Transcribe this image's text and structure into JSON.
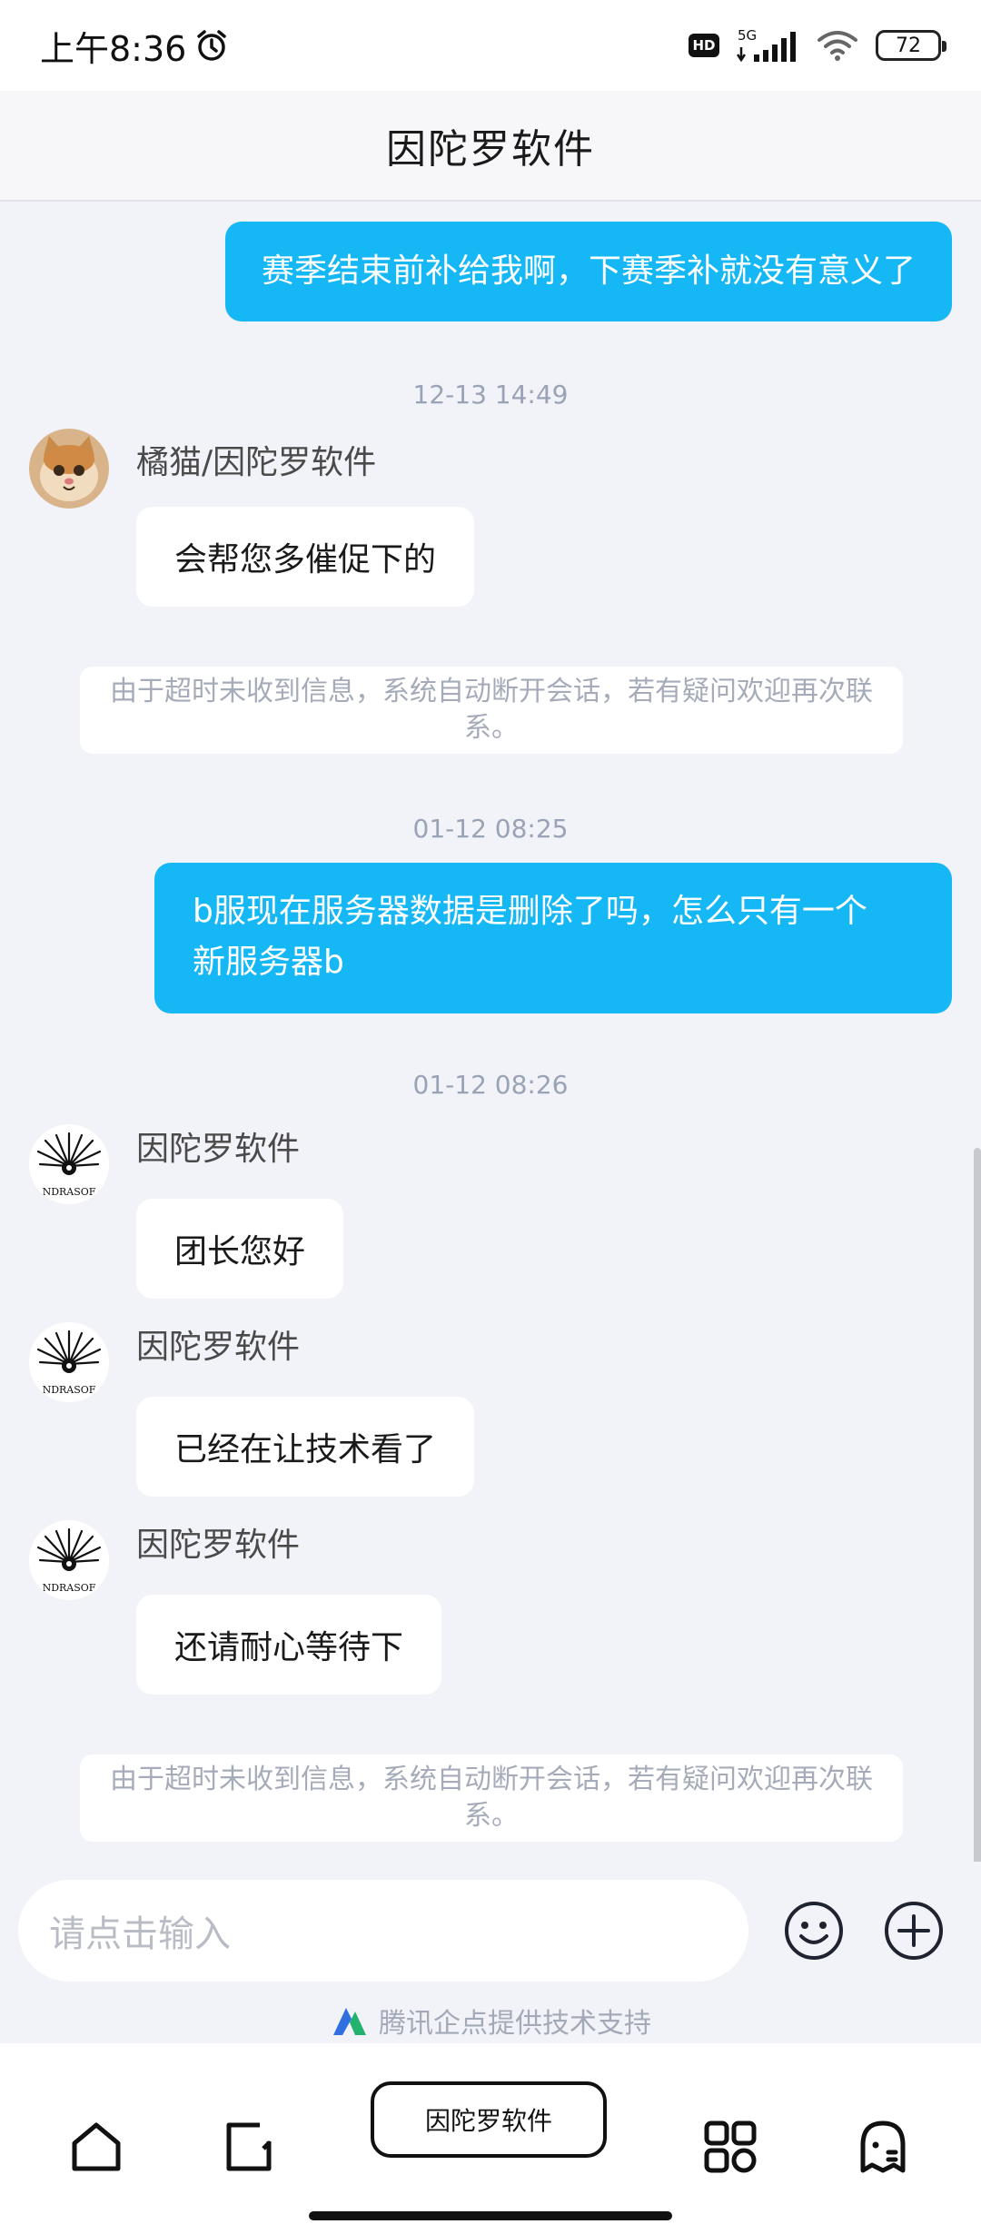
{
  "status": {
    "time": "上午8:36",
    "network": "5G",
    "battery": "72",
    "hd": "HD"
  },
  "header": {
    "title": "因陀罗软件"
  },
  "messages": [
    {
      "type": "out",
      "text": "赛季结束前补给我啊，下赛季补就没有意义了"
    },
    {
      "type": "timestamp",
      "text": "12-13 14:49"
    },
    {
      "type": "in",
      "sender": "橘猫/因陀罗软件",
      "avatar": "cat-avatar",
      "text": "会帮您多催促下的"
    },
    {
      "type": "system",
      "text": "由于超时未收到信息，系统自动断开会话，若有疑问欢迎再次联系。"
    },
    {
      "type": "timestamp",
      "text": "01-12 08:25"
    },
    {
      "type": "out",
      "text_line1": "b服现在服务器数据是删除了吗，怎么只有一个",
      "text_line2": "新服务器b"
    },
    {
      "type": "timestamp",
      "text": "01-12 08:26"
    },
    {
      "type": "in",
      "sender": "因陀罗软件",
      "avatar": "company-logo",
      "logo_text": "NDRASOF",
      "text": "团长您好"
    },
    {
      "type": "in",
      "sender": "因陀罗软件",
      "avatar": "company-logo",
      "logo_text": "NDRASOF",
      "text": "已经在让技术看了"
    },
    {
      "type": "in",
      "sender": "因陀罗软件",
      "avatar": "company-logo",
      "logo_text": "NDRASOF",
      "text": "还请耐心等待下"
    },
    {
      "type": "system",
      "text": "由于超时未收到信息，系统自动断开会话，若有疑问欢迎再次联系。"
    }
  ],
  "input": {
    "placeholder": "请点击输入"
  },
  "footer": {
    "powered_by": "腾讯企点提供技术支持"
  },
  "bottom_nav": {
    "center_label": "因陀罗软件",
    "icons": [
      "home-icon",
      "recent-apps-icon",
      "grid-icon",
      "ghost-icon"
    ]
  },
  "colors": {
    "outgoing_bubble": "#16b7f5",
    "background": "#f2f3f8",
    "timestamp": "#9aa3b5"
  }
}
